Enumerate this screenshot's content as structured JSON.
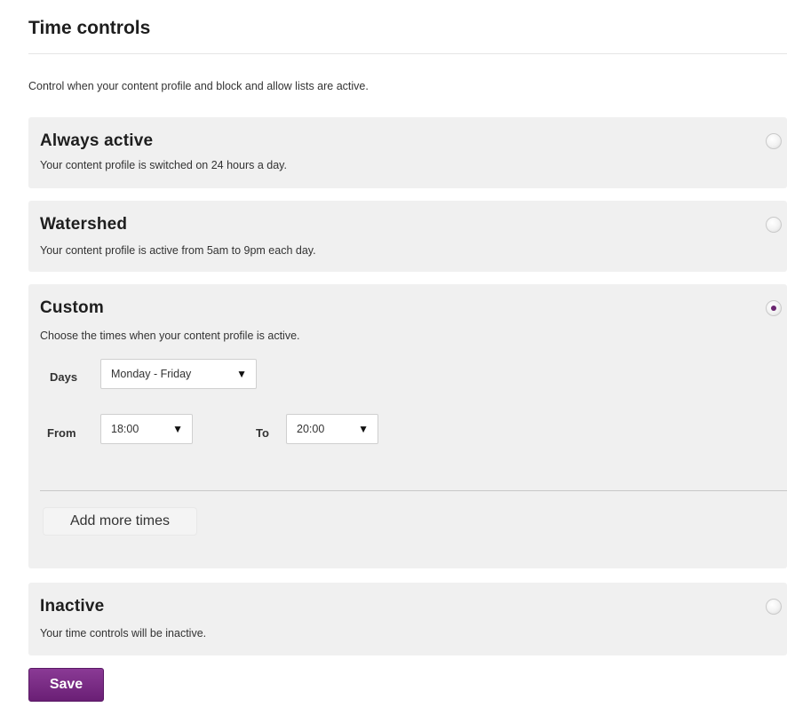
{
  "page": {
    "title": "Time controls",
    "intro": "Control when your content profile and block and allow lists are active."
  },
  "options": [
    {
      "title": "Always active",
      "description": "Your content profile is switched on 24 hours a day.",
      "selected": false
    },
    {
      "title": "Watershed",
      "description": "Your content profile is active from 5am to 9pm each day.",
      "selected": false
    },
    {
      "title": "Custom",
      "description": "Choose the times when your content profile is active.",
      "selected": true
    },
    {
      "title": "Inactive",
      "description": "Your time controls will be inactive.",
      "selected": false
    }
  ],
  "custom": {
    "days_label": "Days",
    "days_value": "Monday - Friday",
    "from_label": "From",
    "from_value": "18:00",
    "to_label": "To",
    "to_value": "20:00",
    "add_more_label": "Add more times"
  },
  "actions": {
    "save_label": "Save"
  },
  "colors": {
    "accent": "#6a2470",
    "panel_bg": "#f0f0f0"
  },
  "icons": {
    "dropdown": "triangle-down-icon",
    "radio": "radio-button-icon"
  }
}
